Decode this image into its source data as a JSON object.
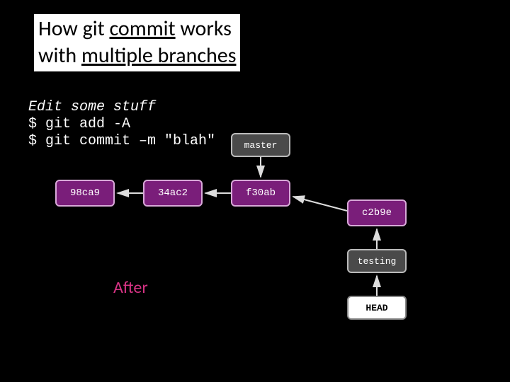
{
  "title": {
    "line1_pre": "How git ",
    "line1_u": "commit",
    "line1_post": " works",
    "line2_pre": "with ",
    "line2_u": "multiple branches"
  },
  "code": {
    "line1": "Edit some stuff",
    "line2": "$ git add -A",
    "line3": "$ git commit –m \"blah\""
  },
  "after_label": "After",
  "nodes": {
    "c1": "98ca9",
    "c2": "34ac2",
    "c3": "f30ab",
    "c4": "c2b9e",
    "master": "master",
    "testing": "testing",
    "head": "HEAD"
  },
  "chart_data": {
    "type": "diagram",
    "title": "How git commit works with multiple branches",
    "nodes": [
      {
        "id": "98ca9",
        "kind": "commit"
      },
      {
        "id": "34ac2",
        "kind": "commit"
      },
      {
        "id": "f30ab",
        "kind": "commit"
      },
      {
        "id": "c2b9e",
        "kind": "commit"
      },
      {
        "id": "master",
        "kind": "branch"
      },
      {
        "id": "testing",
        "kind": "branch"
      },
      {
        "id": "HEAD",
        "kind": "head"
      }
    ],
    "edges": [
      {
        "from": "34ac2",
        "to": "98ca9",
        "meaning": "parent"
      },
      {
        "from": "f30ab",
        "to": "34ac2",
        "meaning": "parent"
      },
      {
        "from": "c2b9e",
        "to": "f30ab",
        "meaning": "parent"
      },
      {
        "from": "master",
        "to": "f30ab",
        "meaning": "points-to"
      },
      {
        "from": "testing",
        "to": "c2b9e",
        "meaning": "points-to"
      },
      {
        "from": "HEAD",
        "to": "testing",
        "meaning": "points-to"
      }
    ],
    "annotations": [
      "After"
    ]
  }
}
